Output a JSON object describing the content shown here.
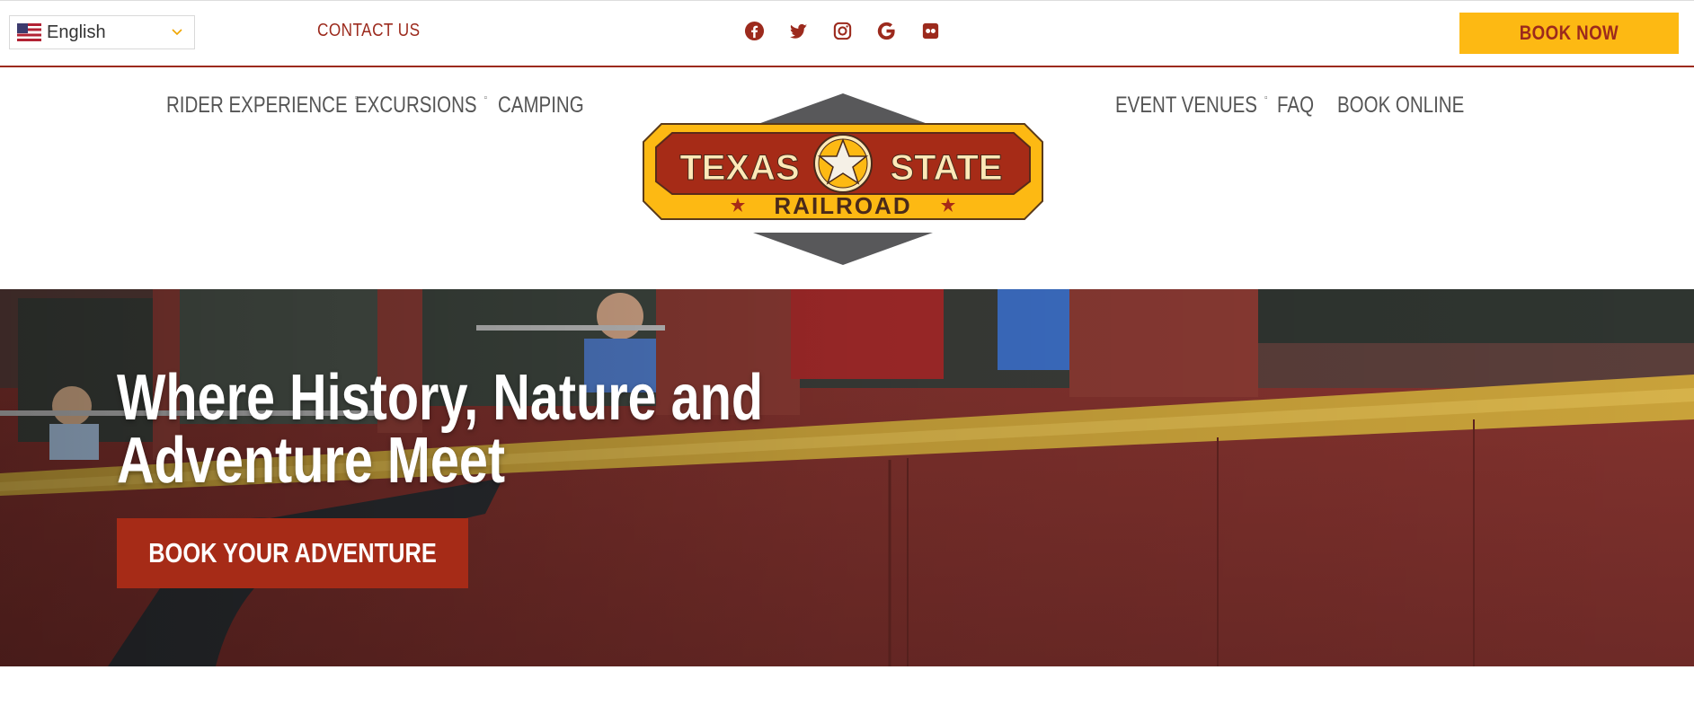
{
  "topbar": {
    "language": {
      "label": "English",
      "flag": "us-flag-icon"
    },
    "contact_label": "CONTACT US",
    "social_icons": [
      "facebook-icon",
      "twitter-icon",
      "instagram-icon",
      "google-icon",
      "flickr-icon"
    ],
    "book_now_label": "BOOK NOW"
  },
  "nav": {
    "left": [
      {
        "label": "RIDER EXPERIENCE",
        "has_dropdown": true
      },
      {
        "label": "EXCURSIONS",
        "has_dropdown": true
      },
      {
        "label": "CAMPING",
        "has_dropdown": false
      }
    ],
    "right": [
      {
        "label": "EVENT VENUES",
        "has_dropdown": true
      },
      {
        "label": "FAQ",
        "has_dropdown": false
      },
      {
        "label": "BOOK ONLINE",
        "has_dropdown": false
      }
    ],
    "caret_glyph": "▫"
  },
  "logo": {
    "line1_left": "TEXAS",
    "line1_right": "STATE",
    "line2": "RAILROAD"
  },
  "hero": {
    "headline_line1": "Where History, Nature and",
    "headline_line2": "Adventure Meet",
    "cta_label": "BOOK YOUR ADVENTURE"
  },
  "colors": {
    "brand_red": "#9c2a1d",
    "brand_yellow": "#fdb913",
    "cta_red": "#a62b17",
    "nav_text": "#555555"
  }
}
